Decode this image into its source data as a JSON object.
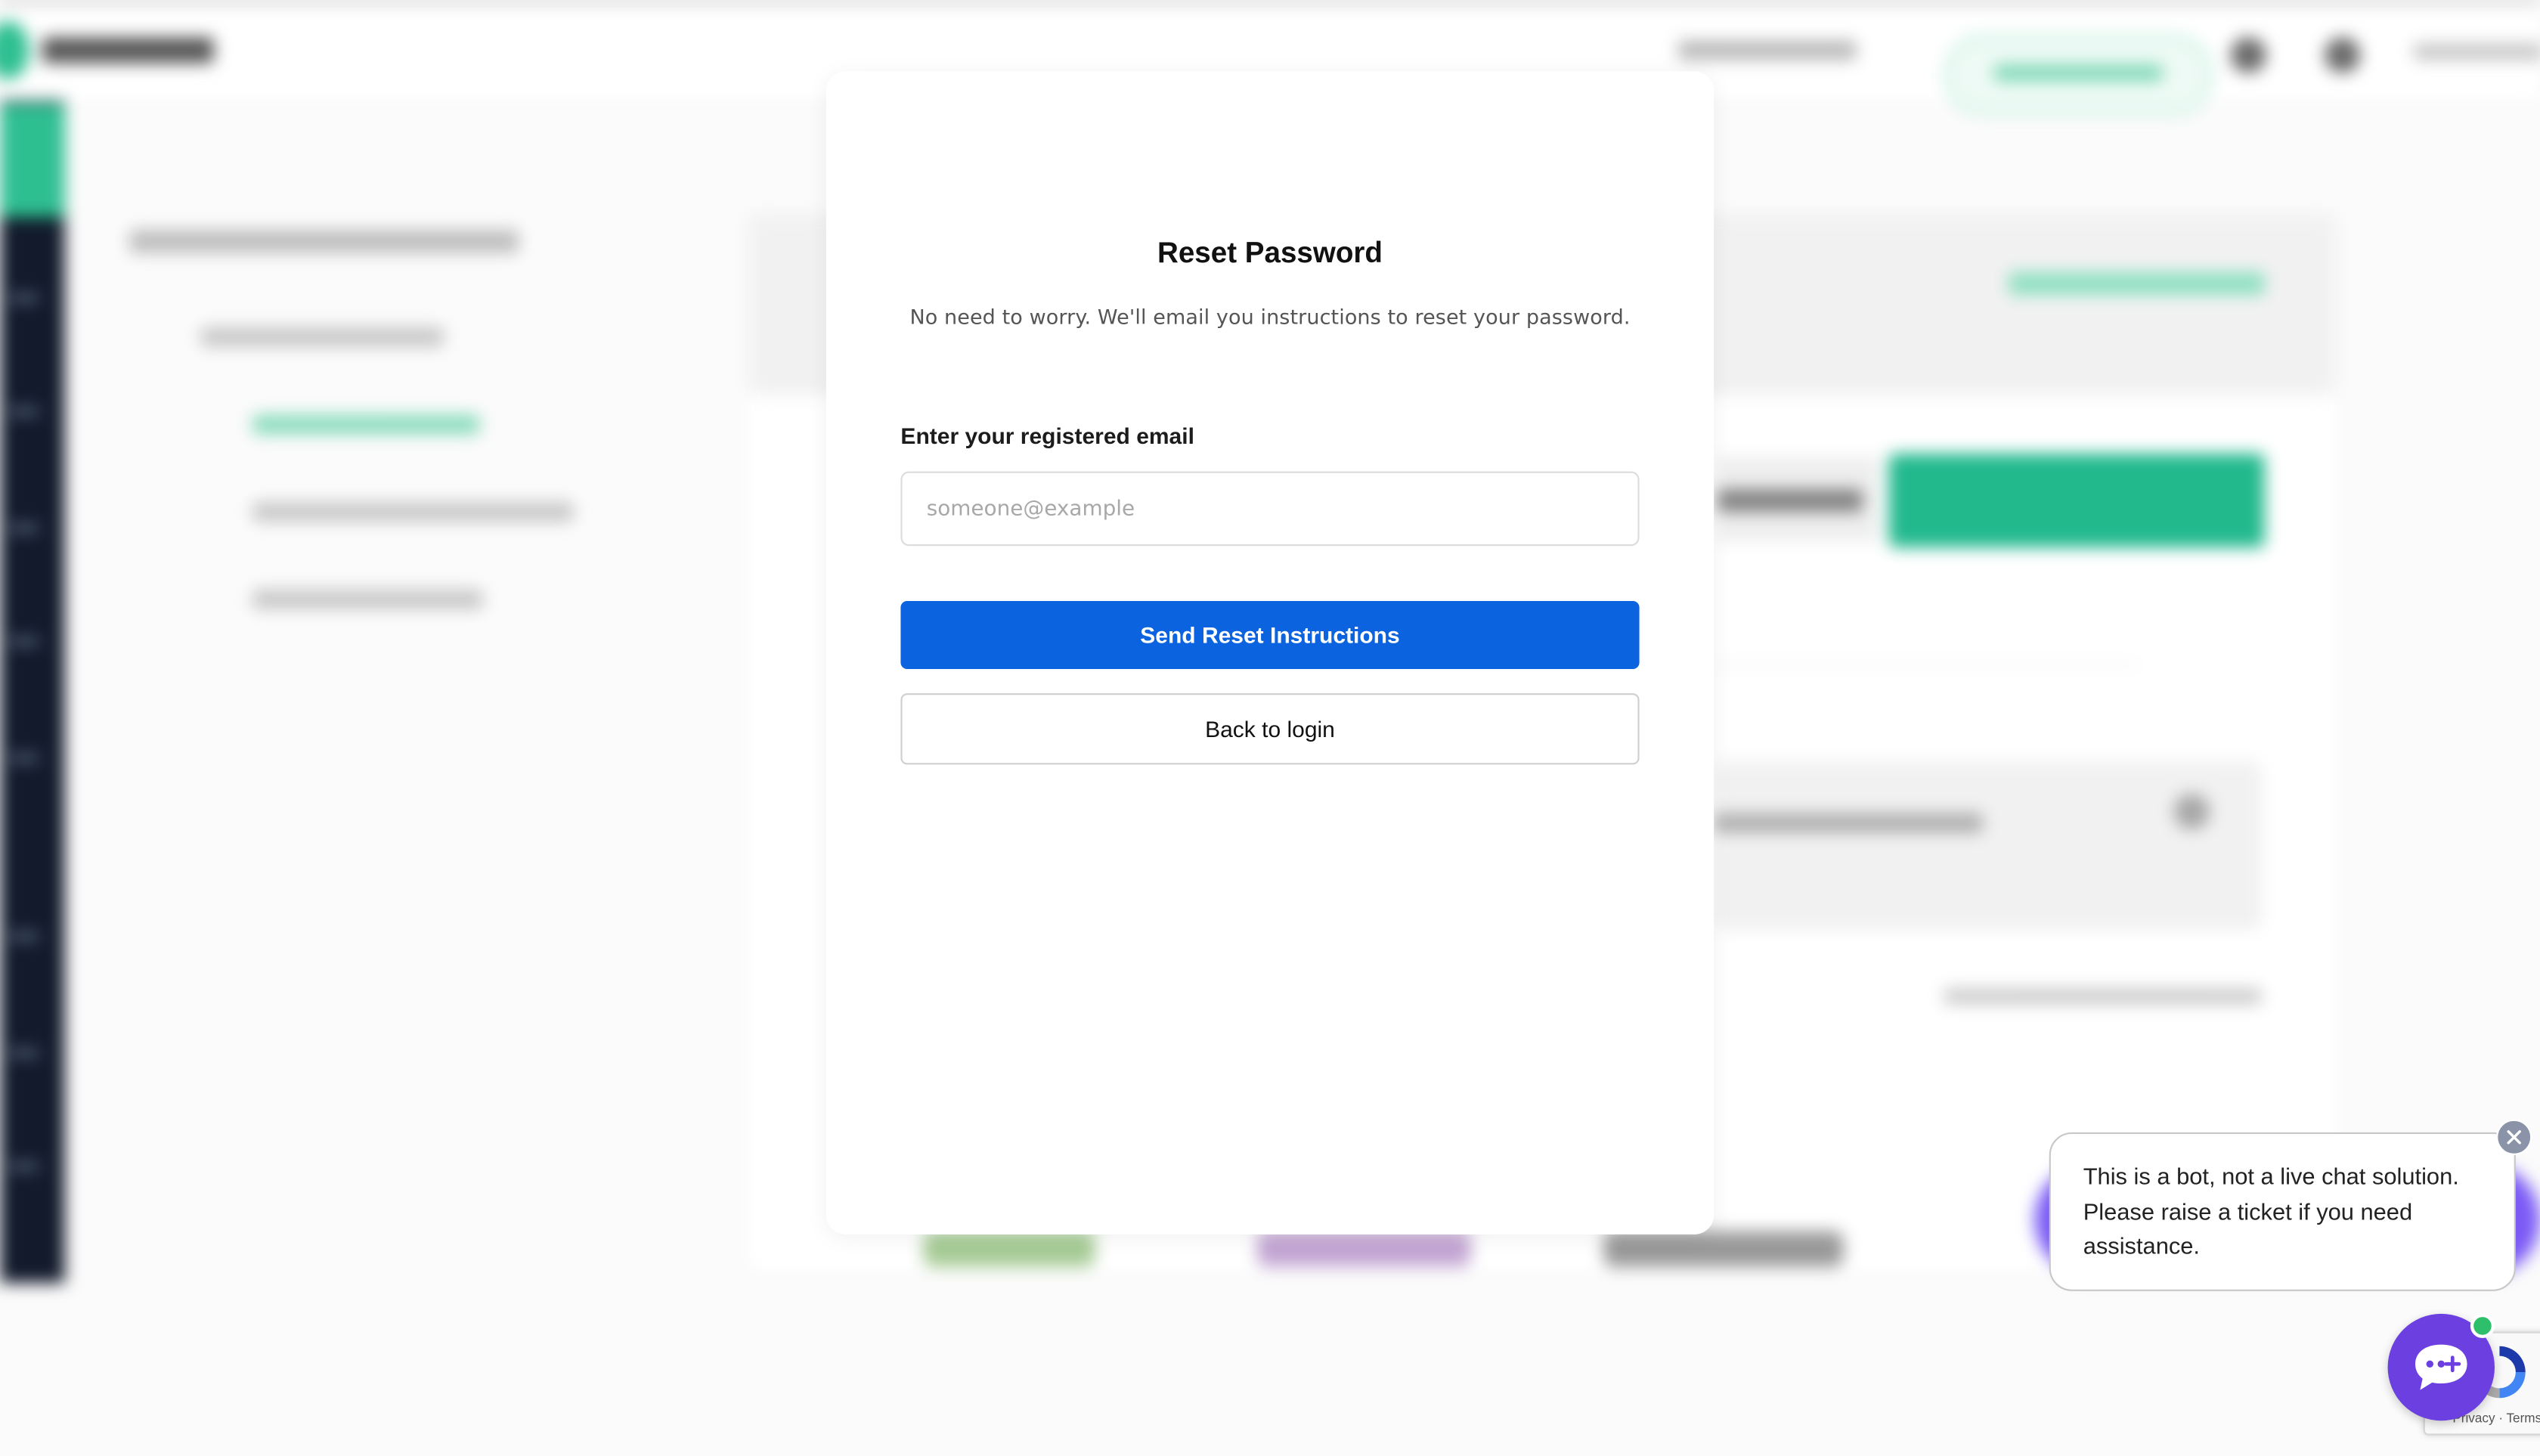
{
  "modal": {
    "title": "Reset Password",
    "subtitle": "No need to worry. We'll email you instructions to reset your password.",
    "email_label": "Enter your registered email",
    "email_value": "",
    "email_placeholder": "someone@example",
    "send_label": "Send Reset Instructions",
    "back_label": "Back to login"
  },
  "chatbot": {
    "tooltip": "This is a bot, not a live chat solution. Please raise a ticket if you need assistance."
  },
  "recaptcha": {
    "terms": "Privacy · Terms"
  },
  "colors": {
    "primary": "#0b63e0",
    "brand_green": "#2ebf91",
    "chat_purple": "#6b3fe0",
    "online_green": "#2ebf6b"
  }
}
